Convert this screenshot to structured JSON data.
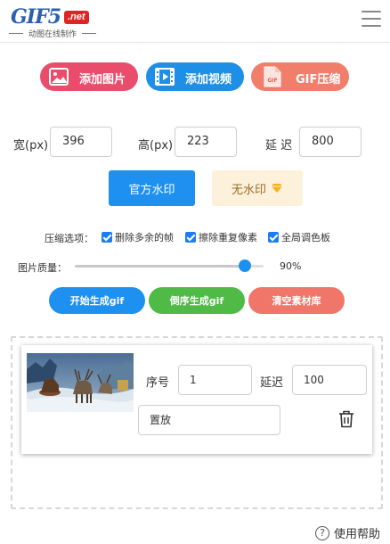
{
  "header": {
    "logo_main": "GIF5",
    "logo_badge": ".net",
    "logo_sub": "动图在线制作",
    "menu_icon": "hamburger-menu-icon"
  },
  "add_buttons": {
    "image": {
      "label": "添加图片",
      "icon": "image-icon",
      "color": "#ea4d6b"
    },
    "video": {
      "label": "添加视频",
      "icon": "film-icon",
      "color": "#1e8fe6"
    },
    "gif": {
      "label": "GIF压缩",
      "icon": "gif-file-icon",
      "icon_text": "GIF",
      "color": "#f17d6b"
    }
  },
  "size": {
    "width_label": "宽(px)",
    "width_value": "396",
    "height_label": "高(px)",
    "height_value": "223",
    "delay_label": "延 迟",
    "delay_value": "800"
  },
  "watermark": {
    "official_label": "官方水印",
    "none_label": "无水印",
    "none_icon": "diamond-icon"
  },
  "compress": {
    "label": "压缩选项：",
    "options": [
      {
        "label": "删除多余的帧",
        "checked": true
      },
      {
        "label": "擦除重复像素",
        "checked": true
      },
      {
        "label": "全局调色板",
        "checked": true
      }
    ]
  },
  "quality": {
    "label": "图片质量：",
    "value": 0.9,
    "display": "90%"
  },
  "actions": {
    "generate": "开始生成gif",
    "reverse": "倒序生成gif",
    "clear": "清空素材库"
  },
  "materials": [
    {
      "seq_label": "序号",
      "seq_value": "1",
      "delay_label": "延迟",
      "delay_value": "100",
      "position_value": "置放",
      "thumbnail": "reindeer-sleigh-scene"
    }
  ],
  "help": {
    "label": "使用帮助",
    "icon": "question-circle-icon"
  }
}
